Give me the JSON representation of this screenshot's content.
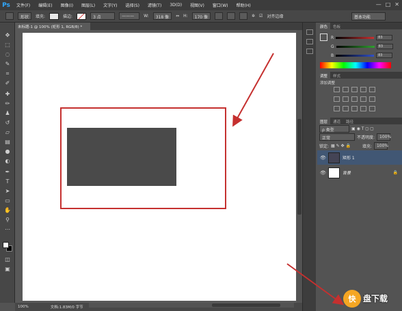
{
  "app": {
    "logo": "Ps"
  },
  "menu": [
    "文件(F)",
    "编辑(E)",
    "图像(I)",
    "图层(L)",
    "文字(Y)",
    "选择(S)",
    "滤镜(T)",
    "3D(D)",
    "视图(V)",
    "窗口(W)",
    "帮助(H)"
  ],
  "window_buttons": [
    "—",
    "□",
    "✕"
  ],
  "options": {
    "shape_mode": "形状",
    "fill_label": "填充:",
    "stroke_label": "描边:",
    "stroke_width": "3 点",
    "w_label": "W:",
    "w_value": "318 像",
    "h_label": "H:",
    "h_value": "170 像",
    "align_edges": "对齐边缘",
    "workspace": "基本功能"
  },
  "document": {
    "tab_title": "未标题-1 @ 100% (矩形 1, RGB/8) *",
    "zoom": "100%",
    "doc_info": "文档:1.83M/0 字节"
  },
  "panels": {
    "color_tabs": [
      "颜色",
      "色板"
    ],
    "sliders": [
      {
        "label": "R",
        "value": "83",
        "color": "#c83030"
      },
      {
        "label": "G",
        "value": "83",
        "color": "#30a030"
      },
      {
        "label": "B",
        "value": "83",
        "color": "#3050c8"
      }
    ],
    "adjust_tabs": [
      "调整",
      "样式"
    ],
    "adjust_title": "添加调整",
    "layers_tabs": [
      "图层",
      "通道",
      "路径"
    ],
    "kind_filter": "ρ 类型",
    "blend_mode": "正常",
    "opacity_label": "不透明度:",
    "opacity_value": "100%",
    "lock_label": "锁定:",
    "fill_label": "填充:",
    "fill_value": "100%",
    "layers": [
      {
        "name": "矩形 1",
        "selected": true
      },
      {
        "name": "背景",
        "selected": false
      }
    ]
  },
  "watermark": {
    "logo": "快",
    "text": "盘下载"
  },
  "colors": {
    "annotation_red": "#c5302f",
    "shape_fill": "#4a4a4a",
    "selection_blue": "#415774"
  }
}
